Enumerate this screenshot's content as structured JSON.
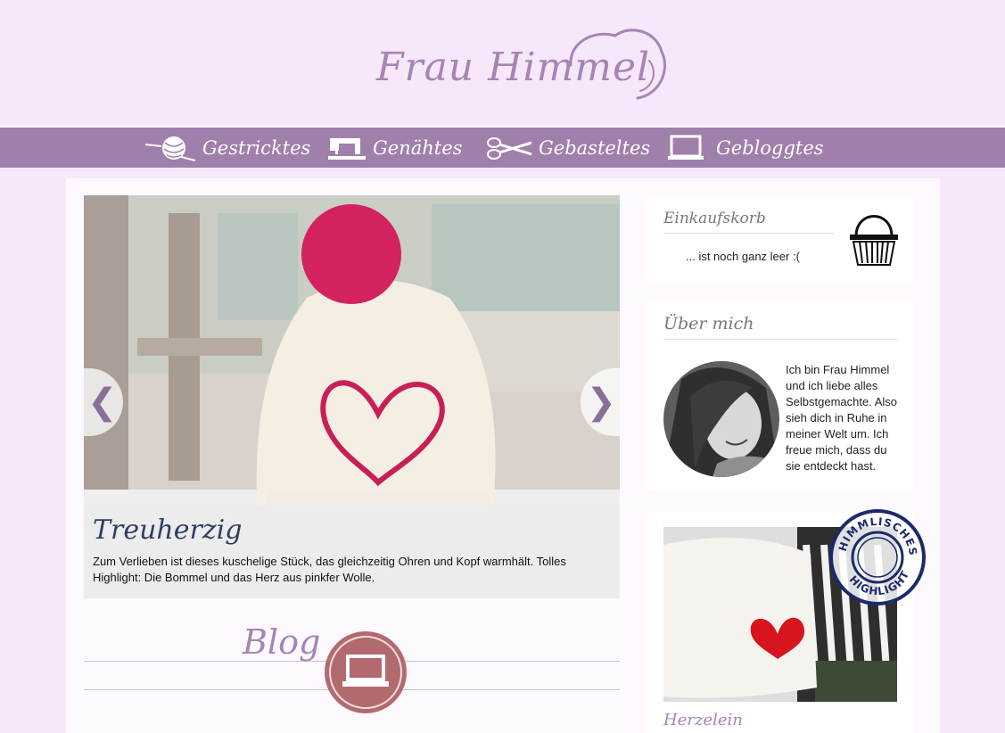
{
  "site": {
    "logo_text": "Frau Himmel"
  },
  "nav": {
    "items": [
      {
        "label": "Gestricktes",
        "icon": "yarn-ball-icon"
      },
      {
        "label": "Genähtes",
        "icon": "sewing-machine-icon"
      },
      {
        "label": "Gebasteltes",
        "icon": "scissors-icon"
      },
      {
        "label": "Gebloggtes",
        "icon": "laptop-icon"
      }
    ]
  },
  "slider": {
    "title": "Treuherzig",
    "text": "Zum Verlieben ist dieses kuschelige Stück, das gleichzeitig Ohren und Kopf warmhält. Tolles Highlight: Die Bommel und das Herz aus pinkfer Wolle.",
    "prev_label": "❮",
    "next_label": "❯"
  },
  "blog": {
    "heading": "Blog"
  },
  "sidebar": {
    "cart": {
      "title": "Einkaufskorb",
      "empty_text": "... ist noch ganz leer :("
    },
    "about": {
      "title": "Über mich",
      "text": "Ich bin Frau Himmel und ich liebe alles Selbstgemachte. Also sieh dich in Ruhe in meiner Welt um. Ich freue mich, dass du sie entdeckt hast."
    },
    "highlight": {
      "stamp_text": "HIMMLISCHES HIGHLIGHT",
      "title": "Herzelein"
    }
  },
  "colors": {
    "background": "#f6e7fa",
    "nav": "#a07fab",
    "accent": "#a485b3",
    "caption_title": "#2f3d66",
    "badge": "#b36a6f"
  }
}
